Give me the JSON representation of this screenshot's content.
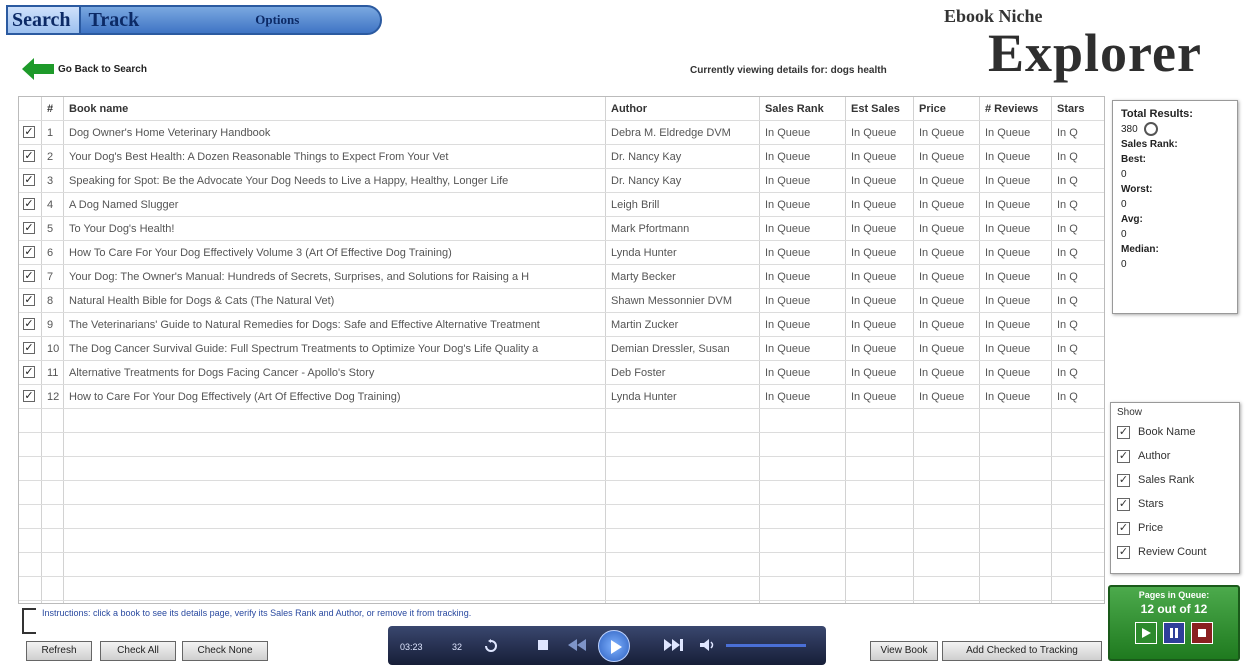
{
  "tabs": {
    "search": "Search",
    "track": "Track",
    "options": "Options"
  },
  "brand": {
    "small": "Ebook Niche",
    "big": "Explorer"
  },
  "back_label": "Go Back to Search",
  "viewing_text": "Currently viewing details for: dogs health",
  "columns": [
    "",
    "#",
    "Book name",
    "Author",
    "Sales Rank",
    "Est Sales",
    "Price",
    "# Reviews",
    "Stars"
  ],
  "rows": [
    {
      "num": "1",
      "name": "Dog Owner's Home Veterinary Handbook",
      "author": "Debra M. Eldredge DVM",
      "rank": "In Queue",
      "sales": "In Queue",
      "price": "In Queue",
      "reviews": "In Queue",
      "stars": "In Q"
    },
    {
      "num": "2",
      "name": "Your Dog's Best Health: A Dozen Reasonable Things to Expect From Your Vet",
      "author": "Dr. Nancy Kay",
      "rank": "In Queue",
      "sales": "In Queue",
      "price": "In Queue",
      "reviews": "In Queue",
      "stars": "In Q"
    },
    {
      "num": "3",
      "name": "Speaking for Spot: Be the Advocate Your Dog Needs to Live a Happy, Healthy, Longer Life",
      "author": "Dr. Nancy Kay",
      "rank": "In Queue",
      "sales": "In Queue",
      "price": "In Queue",
      "reviews": "In Queue",
      "stars": "In Q"
    },
    {
      "num": "4",
      "name": "A Dog Named Slugger",
      "author": "Leigh Brill",
      "rank": "In Queue",
      "sales": "In Queue",
      "price": "In Queue",
      "reviews": "In Queue",
      "stars": "In Q"
    },
    {
      "num": "5",
      "name": "To Your Dog's Health!",
      "author": "Mark Pfortmann",
      "rank": "In Queue",
      "sales": "In Queue",
      "price": "In Queue",
      "reviews": "In Queue",
      "stars": "In Q"
    },
    {
      "num": "6",
      "name": "How To Care For Your Dog Effectively Volume 3 (Art Of Effective Dog Training)",
      "author": "Lynda Hunter",
      "rank": "In Queue",
      "sales": "In Queue",
      "price": "In Queue",
      "reviews": "In Queue",
      "stars": "In Q"
    },
    {
      "num": "7",
      "name": "Your Dog: The Owner's Manual: Hundreds of Secrets, Surprises, and Solutions for Raising a H",
      "author": "Marty Becker",
      "rank": "In Queue",
      "sales": "In Queue",
      "price": "In Queue",
      "reviews": "In Queue",
      "stars": "In Q"
    },
    {
      "num": "8",
      "name": "Natural Health Bible for Dogs & Cats (The Natural Vet)",
      "author": "Shawn Messonnier DVM",
      "rank": "In Queue",
      "sales": "In Queue",
      "price": "In Queue",
      "reviews": "In Queue",
      "stars": "In Q"
    },
    {
      "num": "9",
      "name": "The Veterinarians' Guide to Natural Remedies for Dogs: Safe and Effective Alternative Treatment",
      "author": "Martin Zucker",
      "rank": "In Queue",
      "sales": "In Queue",
      "price": "In Queue",
      "reviews": "In Queue",
      "stars": "In Q"
    },
    {
      "num": "10",
      "name": "The Dog Cancer Survival Guide: Full Spectrum Treatments to Optimize Your Dog's Life Quality a",
      "author": "Demian Dressler, Susan",
      "rank": "In Queue",
      "sales": "In Queue",
      "price": "In Queue",
      "reviews": "In Queue",
      "stars": "In Q"
    },
    {
      "num": "11",
      "name": "Alternative Treatments for Dogs Facing Cancer - Apollo's Story",
      "author": "Deb Foster",
      "rank": "In Queue",
      "sales": "In Queue",
      "price": "In Queue",
      "reviews": "In Queue",
      "stars": "In Q"
    },
    {
      "num": "12",
      "name": "How to Care For Your Dog Effectively (Art Of Effective Dog Training)",
      "author": "Lynda Hunter",
      "rank": "In Queue",
      "sales": "In Queue",
      "price": "In Queue",
      "reviews": "In Queue",
      "stars": "In Q"
    }
  ],
  "totals": {
    "title": "Total Results:",
    "count": "380",
    "sales_rank_label": "Sales Rank:",
    "best_label": "Best:",
    "best": "0",
    "worst_label": "Worst:",
    "worst": "0",
    "avg_label": "Avg:",
    "avg": "0",
    "median_label": "Median:",
    "median": "0"
  },
  "show": {
    "title": "Show",
    "options": [
      "Book Name",
      "Author",
      "Sales Rank",
      "Stars",
      "Price",
      "Review Count"
    ]
  },
  "queue": {
    "label": "Pages in Queue:",
    "value": "12 out of 12"
  },
  "status_text": "Instructions: click a book to see its details page, verify its Sales Rank and Author, or remove it from tracking.",
  "buttons": {
    "refresh": "Refresh",
    "check_all": "Check All",
    "check_none": "Check None",
    "view_book": "View Book",
    "add_tracking": "Add Checked to Tracking"
  },
  "player": {
    "time": "03:23",
    "chapter": "32"
  },
  "check_mark": "✓",
  "colors": {
    "tab_blue": "#3f74c4",
    "queue_green": "#2d8a2d",
    "arrow_green": "#1e9a2a"
  }
}
